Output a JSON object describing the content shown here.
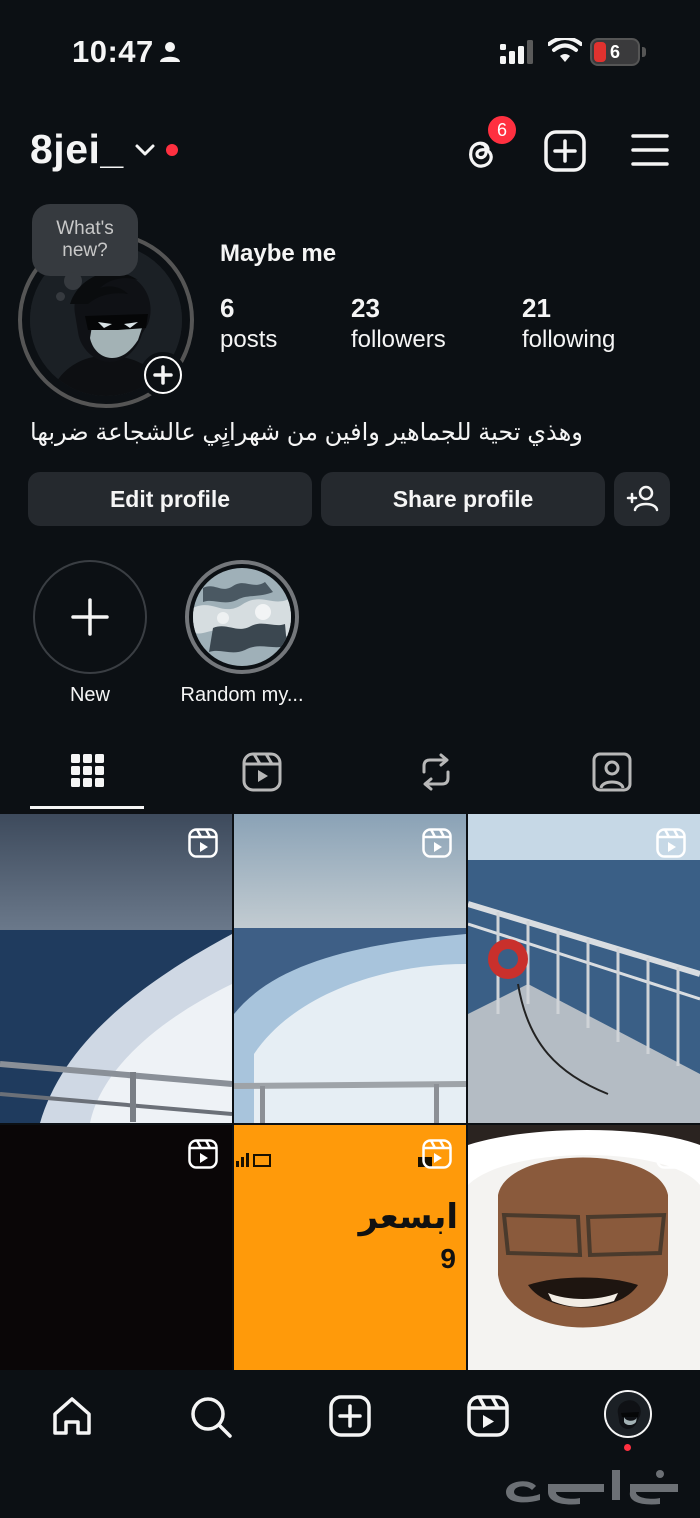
{
  "status_bar": {
    "time": "10:47",
    "battery": "6"
  },
  "header": {
    "username": "8jei_",
    "threads_badge": "6"
  },
  "profile": {
    "note": "What's new?",
    "name": "Maybe me",
    "stats": [
      {
        "value": "6",
        "label": "posts"
      },
      {
        "value": "23",
        "label": "followers"
      },
      {
        "value": "21",
        "label": "following"
      }
    ],
    "bio": "وهذي تحية للجماهير وافين من شهرانٍي عالشجاعة ضربها"
  },
  "buttons": {
    "edit": "Edit profile",
    "share": "Share profile"
  },
  "highlights": [
    {
      "label": "New"
    },
    {
      "label": "Random my..."
    }
  ],
  "grid": {
    "cells": [
      {
        "type": "reel",
        "scene": "sea-wake-dusk"
      },
      {
        "type": "reel",
        "scene": "sea-wake-day"
      },
      {
        "type": "reel",
        "scene": "boat-deck"
      },
      {
        "type": "reel",
        "scene": "dark"
      },
      {
        "type": "reel",
        "scene": "phone-screen",
        "text_line1": "ابسعر",
        "text_line2": "9"
      },
      {
        "type": "reel",
        "scene": "portrait"
      }
    ]
  },
  "watermark": "حراج",
  "colors": {
    "background": "#0c1014",
    "button": "#25292e",
    "accent_red": "#ff3040",
    "phone_orange": "#ff9a0a"
  }
}
